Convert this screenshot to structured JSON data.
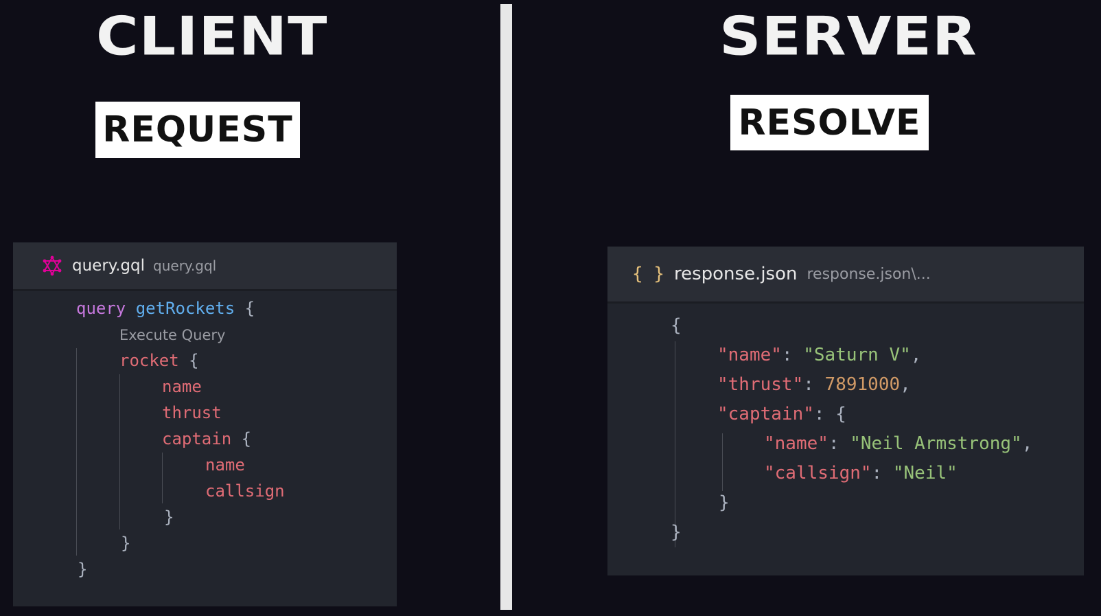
{
  "client": {
    "heading": "CLIENT",
    "tag": "REQUEST",
    "tab": {
      "filename": "query.gql",
      "path": "query.gql",
      "icon": "graphql-icon",
      "icon_color": "#e10098"
    },
    "code": {
      "keyword": "query",
      "operation": "getRockets",
      "open_brace": "{",
      "codelens": "Execute Query",
      "rocket": "rocket",
      "rocket_brace": "{",
      "name": "name",
      "thrust": "thrust",
      "captain": "captain",
      "captain_brace": "{",
      "captain_name": "name",
      "callsign": "callsign",
      "close1": "}",
      "close2": "}",
      "close3": "}"
    }
  },
  "server": {
    "heading": "SERVER",
    "tag": "RESOLVE",
    "tab": {
      "filename": "response.json",
      "path": "response.json\\...",
      "icon": "json-braces-icon",
      "icon_text": "{ }",
      "icon_color": "#e5c07b"
    },
    "code": {
      "open": "{",
      "name_key": "\"name\"",
      "name_val": "\"Saturn V\"",
      "thrust_key": "\"thrust\"",
      "thrust_val": "7891000",
      "captain_key": "\"captain\"",
      "captain_open": "{",
      "cname_key": "\"name\"",
      "cname_val": "\"Neil Armstrong\"",
      "callsign_key": "\"callsign\"",
      "callsign_val": "\"Neil\"",
      "captain_close": "}",
      "close": "}",
      "colon": ": ",
      "comma": ","
    }
  }
}
